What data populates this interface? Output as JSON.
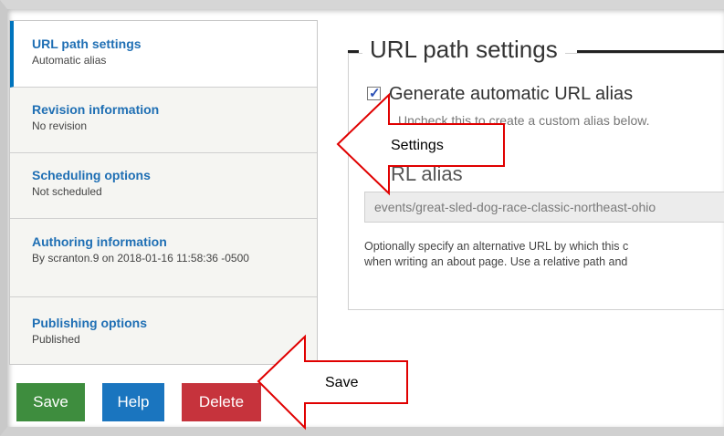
{
  "tabs": [
    {
      "title": "URL path settings",
      "summary": "Automatic alias",
      "active": true
    },
    {
      "title": "Revision information",
      "summary": "No revision"
    },
    {
      "title": "Scheduling options",
      "summary": "Not scheduled"
    },
    {
      "title": "Authoring information",
      "summary": "By scranton.9 on 2018-01-16 11:58:36 -0500"
    },
    {
      "title": "Publishing options",
      "summary": "Published"
    }
  ],
  "details": {
    "legend": "URL path settings",
    "checkbox_checked": true,
    "checkbox_label": "Generate automatic URL alias",
    "checkbox_description": "Uncheck this to create a custom alias below.",
    "alias_label": "RL alias",
    "alias_value": "events/great-sled-dog-race-classic-northeast-ohio",
    "help_line1": "Optionally specify an alternative URL by which this c",
    "help_line2": "when writing an about page. Use a relative path and"
  },
  "buttons": {
    "save": "Save",
    "help": "Help",
    "delete": "Delete"
  },
  "annotations": {
    "settings_callout": "Settings",
    "save_callout": "Save"
  },
  "colors": {
    "save": "#3e8d3e",
    "help": "#1a75bf",
    "delete": "#c6333c",
    "tab_link": "#1f6fb4",
    "callout": "#e00000"
  }
}
